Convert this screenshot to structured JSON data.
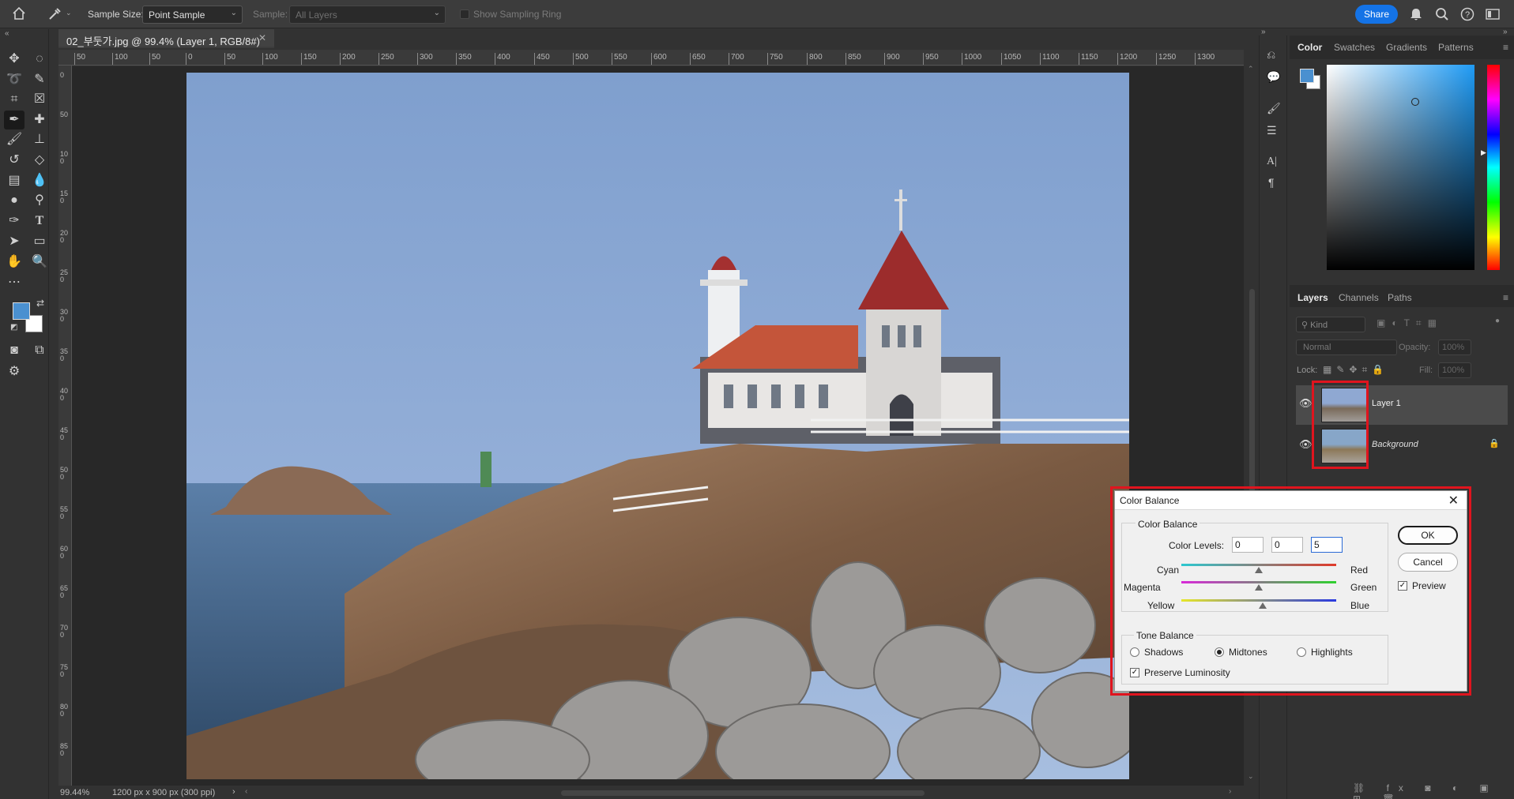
{
  "options_bar": {
    "home_icon": "home-icon",
    "tool_icon": "eyedropper-icon",
    "sample_size_label": "Sample Size:",
    "sample_size_value": "Point Sample",
    "sample_label": "Sample:",
    "sample_value": "All Layers",
    "show_sampling_ring_label": "Show Sampling Ring",
    "share_label": "Share"
  },
  "document": {
    "tab_title": "02_부둣가.jpg @ 99.4% (Layer 1, RGB/8#) *",
    "zoom": "99.44%",
    "info": "1200 px x 900 px (300 ppi)"
  },
  "ruler": {
    "h_ticks": [
      "50",
      "100",
      "50",
      "0",
      "50",
      "100",
      "150",
      "200",
      "250",
      "300",
      "350",
      "400",
      "450",
      "500",
      "550",
      "600",
      "650",
      "700",
      "750",
      "800",
      "850",
      "900",
      "950",
      "1000",
      "1050",
      "1100",
      "1150",
      "1200",
      "1250",
      "1300"
    ],
    "v_ticks": [
      "0",
      "50",
      "100",
      "150",
      "200",
      "250",
      "300",
      "350",
      "400",
      "450",
      "500",
      "550",
      "600",
      "650",
      "700",
      "750",
      "800",
      "850"
    ]
  },
  "color_panel": {
    "tabs": [
      "Color",
      "Swatches",
      "Gradients",
      "Patterns"
    ],
    "foreground": "#4a90d0",
    "background": "#ffffff"
  },
  "layers_panel": {
    "tabs": [
      "Layers",
      "Channels",
      "Paths"
    ],
    "kind_label": "Kind",
    "blend_mode": "Normal",
    "opacity_label": "Opacity:",
    "opacity_value": "100%",
    "lock_label": "Lock:",
    "fill_label": "Fill:",
    "fill_value": "100%",
    "layers": [
      {
        "name": "Layer 1",
        "selected": true
      },
      {
        "name": "Background",
        "selected": false
      }
    ]
  },
  "dialog": {
    "title": "Color Balance",
    "section_color_balance": "Color Balance",
    "color_levels_label": "Color Levels:",
    "levels": [
      "0",
      "0",
      "5"
    ],
    "sliders": [
      {
        "left": "Cyan",
        "right": "Red",
        "value": 0
      },
      {
        "left": "Magenta",
        "right": "Green",
        "value": 0
      },
      {
        "left": "Yellow",
        "right": "Blue",
        "value": 5
      }
    ],
    "section_tone_balance": "Tone Balance",
    "tones": [
      "Shadows",
      "Midtones",
      "Highlights"
    ],
    "selected_tone": "Midtones",
    "preserve_luminosity_label": "Preserve Luminosity",
    "preserve_luminosity": true,
    "ok_label": "OK",
    "cancel_label": "Cancel",
    "preview_label": "Preview",
    "preview": true
  }
}
